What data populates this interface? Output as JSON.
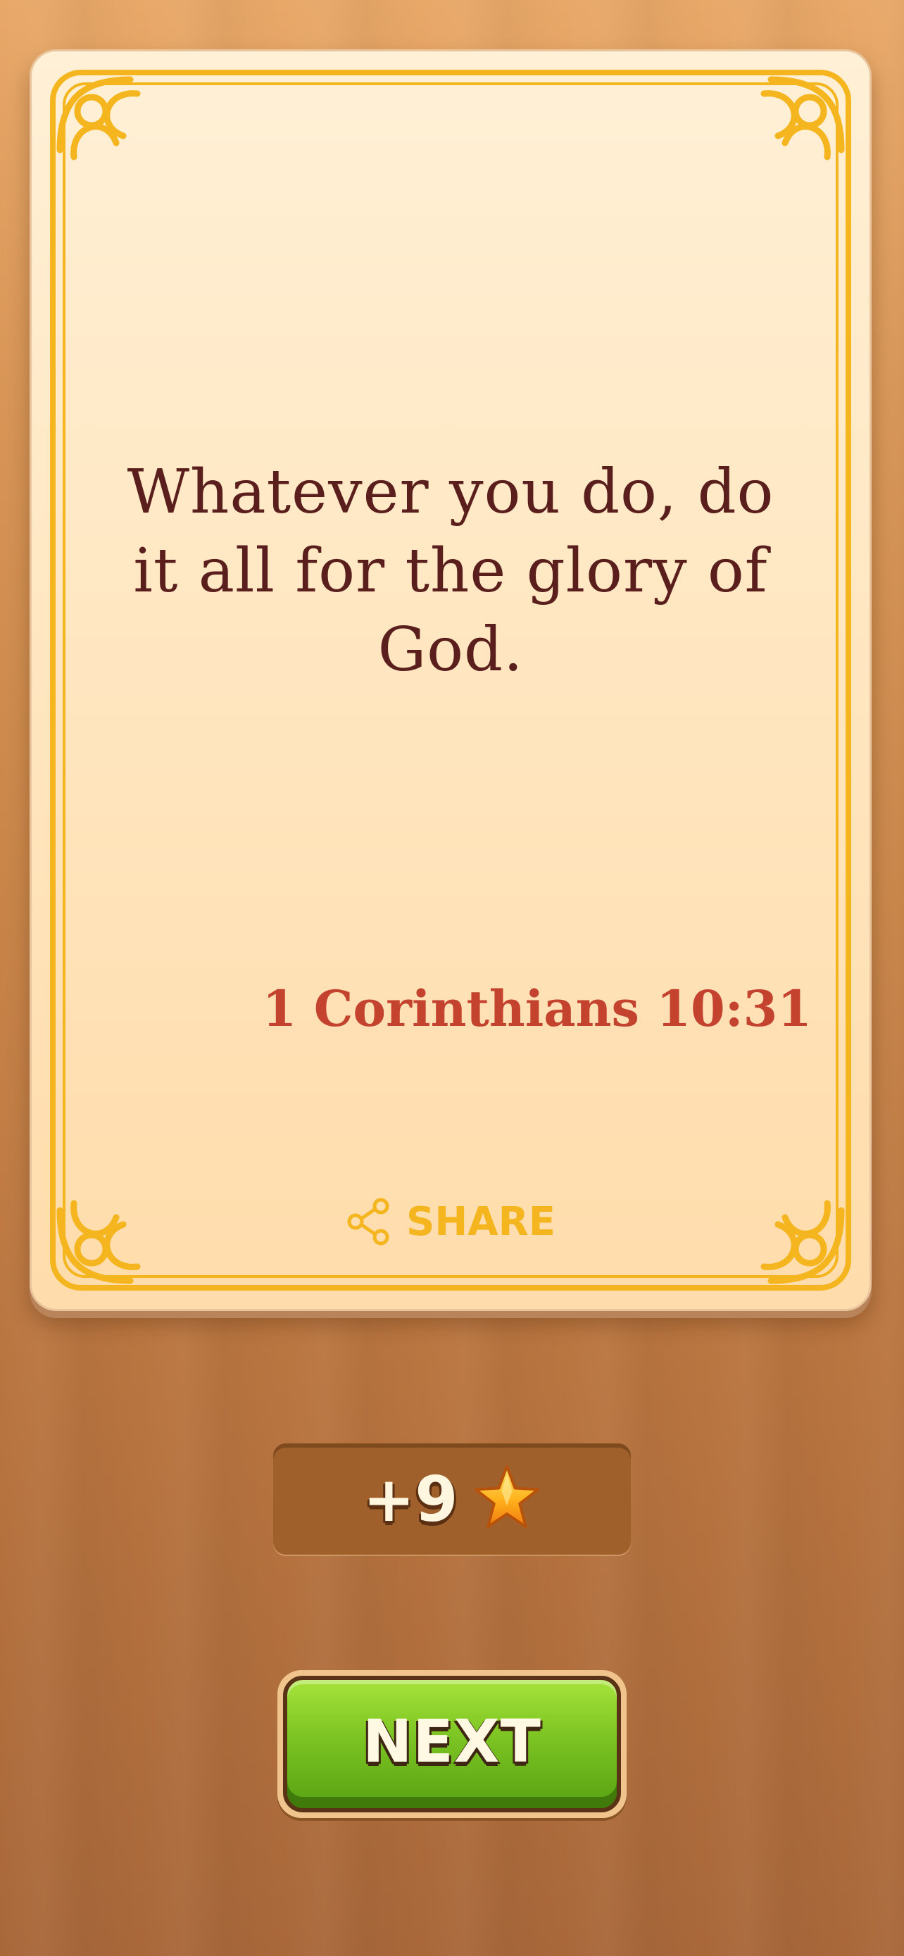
{
  "card": {
    "verse": "Whatever you do, do it all for the glory of God.",
    "reference": "1 Corinthians 10:31",
    "share_label": "SHARE"
  },
  "reward": {
    "value": "+9",
    "icon": "star-icon"
  },
  "next_button": {
    "label": "NEXT"
  },
  "colors": {
    "verse_text": "#5a1e1c",
    "reference_text": "#c4432e",
    "frame_gold": "#f5b51e",
    "next_green": "#7cc423"
  }
}
